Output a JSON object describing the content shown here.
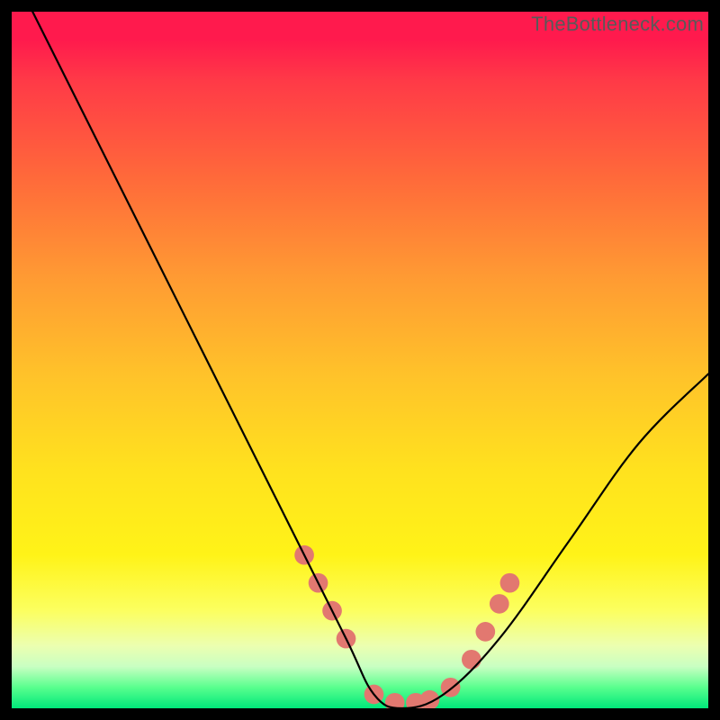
{
  "watermark": "TheBottleneck.com",
  "chart_data": {
    "type": "line",
    "title": "",
    "xlabel": "",
    "ylabel": "",
    "xlim": [
      0,
      100
    ],
    "ylim": [
      0,
      100
    ],
    "grid": false,
    "legend": false,
    "background": "rainbow-gradient (red top → green bottom)",
    "annotations": [
      "salmon dotted markers along valley of curve"
    ],
    "series": [
      {
        "name": "bottleneck-curve",
        "color": "#000000",
        "x": [
          3,
          10,
          20,
          30,
          40,
          48,
          52,
          56,
          62,
          70,
          80,
          90,
          100
        ],
        "values": [
          100,
          86,
          66,
          46,
          26,
          10,
          2,
          0,
          2,
          10,
          24,
          38,
          48
        ]
      }
    ],
    "markers": {
      "name": "valley-dots",
      "color": "#e27870",
      "radius_pct": 1.4,
      "x": [
        42,
        44,
        46,
        48,
        52,
        55,
        58,
        60,
        63,
        66,
        68,
        70,
        71.5
      ],
      "values": [
        22,
        18,
        14,
        10,
        2,
        0.8,
        0.8,
        1.2,
        3,
        7,
        11,
        15,
        18
      ]
    }
  }
}
